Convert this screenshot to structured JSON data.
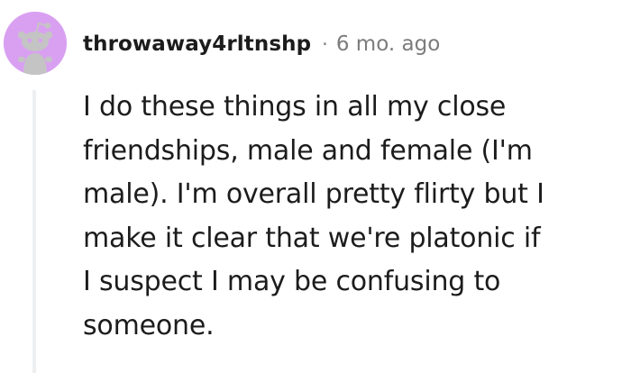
{
  "comment": {
    "author": "throwaway4rltnshp",
    "separator": "·",
    "age": "6 mo. ago",
    "avatar_icon": "snoo-avatar-icon",
    "avatar_color": "#d9a0f2",
    "body_lines": [
      "I do these things in all my close",
      "friendships, male and female (I'm",
      "male). I'm overall pretty flirty but I",
      "make it clear that we're platonic if",
      "I suspect I may be confusing to",
      "someone."
    ]
  }
}
